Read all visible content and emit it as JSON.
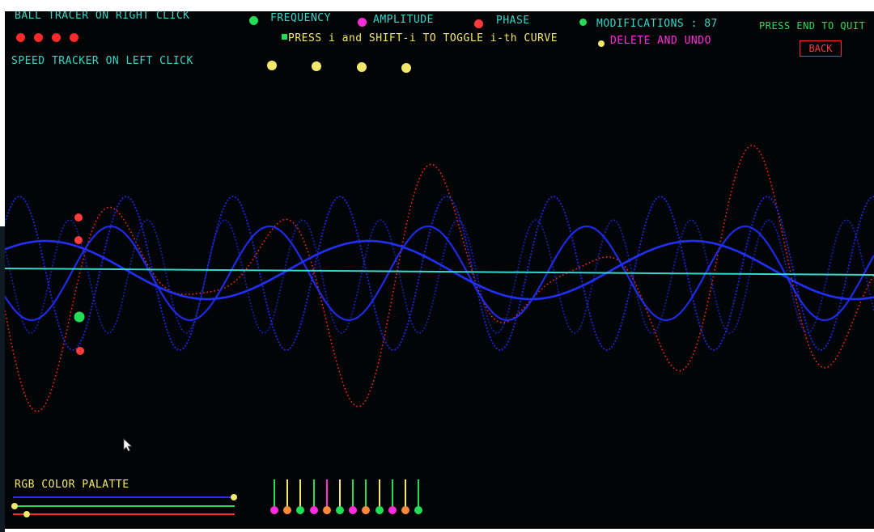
{
  "header": {
    "ball_tracker_label": "BALL TRACER ON RIGHT CLICK",
    "speed_tracker_label": "SPEED TRACKER ON LEFT CLICK",
    "frequency_label": "FREQUENCY",
    "amplitude_label": "AMPLITUDE",
    "phase_label": "PHASE",
    "toggle_hint": "PRESS i and SHIFT-i TO TOGGLE i-th CURVE",
    "modifications_label": "MODIFICATIONS : 87",
    "delete_undo_label": "DELETE AND UNDO",
    "quit_label": "PRESS END TO QUIT",
    "back_label": "BACK"
  },
  "palette": {
    "label": "RGB COLOR PALATTE"
  },
  "colors": {
    "cyan_text": "#36d6c8",
    "green": "#22dd55",
    "magenta": "#ff2ddc",
    "red": "#ff3b3b",
    "yellow": "#f2e96a",
    "blue_curve": "#2030ff",
    "red_curve": "#ff2a2a",
    "axis": "#33d9cc",
    "orange": "#ff8a3c"
  },
  "icons": {
    "cursor": "mouse-pointer-icon"
  }
}
